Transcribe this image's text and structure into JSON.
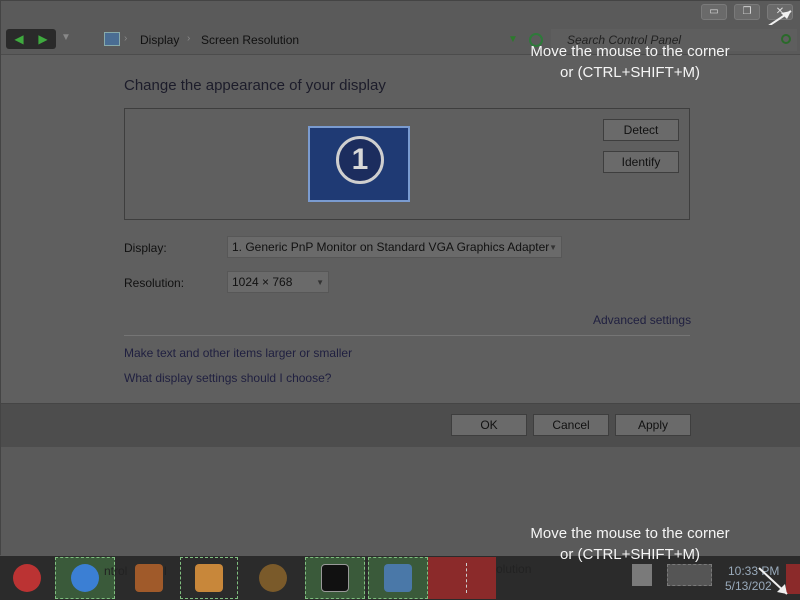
{
  "window": {
    "caption_minimize": "▭",
    "caption_restore": "❐",
    "caption_close": "✕"
  },
  "nav": {
    "back": "◀",
    "forward": "▶",
    "dropdown": "▼",
    "breadcrumb": [
      "Display",
      "Screen Resolution"
    ],
    "sep": "›",
    "search_placeholder": "Search Control Panel"
  },
  "main": {
    "heading": "Change the appearance of your display",
    "detect_label": "Detect",
    "identify_label": "Identify",
    "monitor_number": "1",
    "display_label": "Display:",
    "display_value": "1. Generic PnP Monitor on Standard VGA Graphics Adapter",
    "resolution_label": "Resolution:",
    "resolution_value": "1024 × 768",
    "advanced_link": "Advanced settings",
    "link_larger": "Make text and other items larger or smaller",
    "link_help": "What display settings should I choose?"
  },
  "footer": {
    "ok_label": "OK",
    "cancel_label": "Cancel",
    "apply_label": "Apply"
  },
  "overlay": {
    "hint_line1": "Move the mouse to the corner",
    "hint_line2": "or (CTRL+SHIFT+M)"
  },
  "taskbar": {
    "item_partial_1": "ntrol",
    "item_partial_2": "l",
    "item_partial_3": "olution",
    "time": "10:33 PM",
    "date": "5/13/202"
  },
  "colors": {
    "accent_green": "#3faa3f",
    "dim_background": "#5f5f5f",
    "taskbar_red": "#8b2a2a"
  },
  "icons": {
    "nav_back": "back-arrow-icon",
    "nav_forward": "forward-arrow-icon",
    "breadcrumb": "display-icon",
    "search": "search-icon",
    "refresh": "refresh-icon",
    "corner": "arrow-to-corner-icon"
  }
}
